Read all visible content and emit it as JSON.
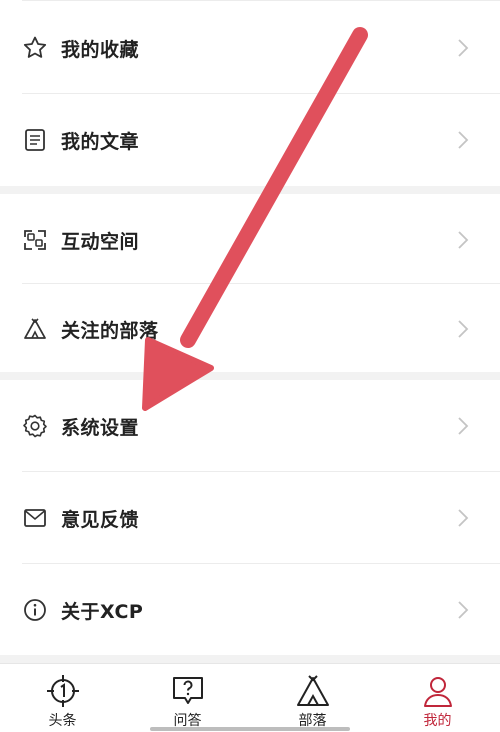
{
  "menu": {
    "items": [
      {
        "label": "我的收藏",
        "icon": "star-icon"
      },
      {
        "label": "我的文章",
        "icon": "document-icon"
      },
      {
        "label": "互动空间",
        "icon": "interaction-icon"
      },
      {
        "label": "关注的部落",
        "icon": "tent-icon"
      },
      {
        "label": "系统设置",
        "icon": "gear-icon"
      },
      {
        "label": "意见反馈",
        "icon": "mail-icon"
      },
      {
        "label": "关于XCP",
        "icon": "info-icon"
      }
    ]
  },
  "tabbar": {
    "tabs": [
      {
        "label": "头条",
        "icon": "target-icon"
      },
      {
        "label": "问答",
        "icon": "question-bubble-icon"
      },
      {
        "label": "部落",
        "icon": "tent-icon"
      },
      {
        "label": "我的",
        "icon": "person-icon",
        "active": true
      }
    ]
  },
  "colors": {
    "accent": "#c0263a",
    "arrow": "#e0505c",
    "divider": "#ececec",
    "section_gap": "#f2f2f2"
  }
}
